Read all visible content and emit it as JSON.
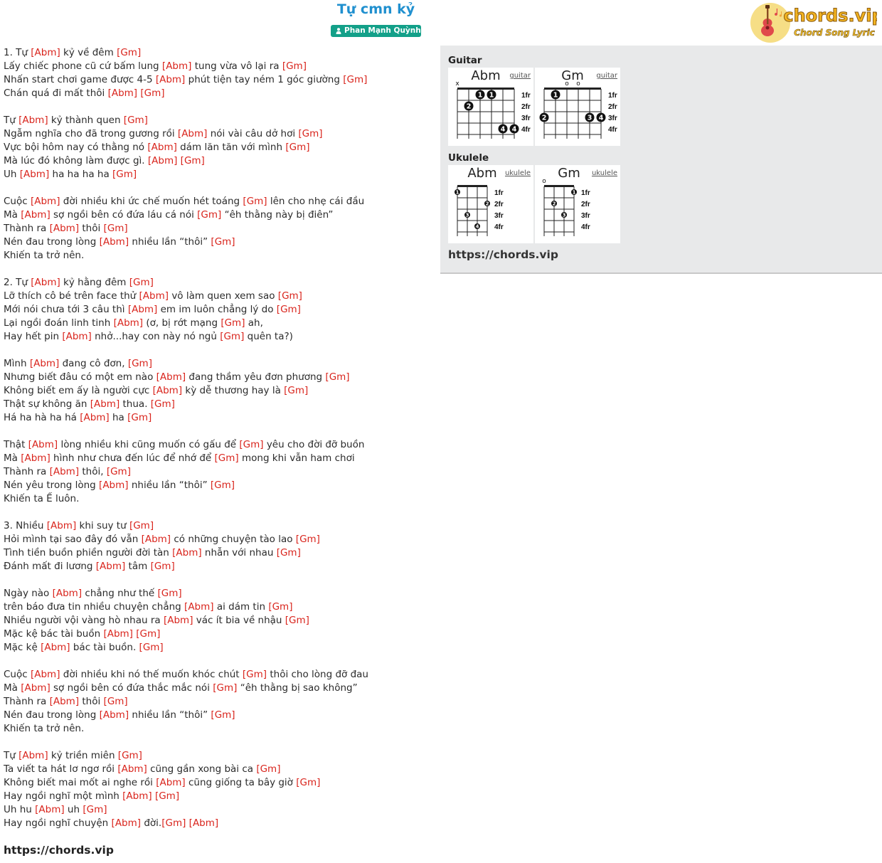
{
  "header": {
    "title": "Tự cmn kỷ",
    "artist": "Phan Mạnh Quỳnh"
  },
  "logo": {
    "brand": "chords.vip",
    "tagline": "Chord Song Lyric"
  },
  "colors": {
    "title": "#2090cf",
    "chord": "#d9241c",
    "badge": "#13a089",
    "panel": "#e8e9ea"
  },
  "lyrics": [
    [
      "1. Tự ",
      "[Abm]",
      " kỷ về đêm ",
      "[Gm]"
    ],
    [
      "Lấy chiếc phone cũ cứ bấm lung ",
      "[Abm]",
      " tung vừa vô lại ra ",
      "[Gm]"
    ],
    [
      "Nhấn start chơi game được 4-5 ",
      "[Abm]",
      " phút tiện tay ném 1 góc giường ",
      "[Gm]"
    ],
    [
      "Chán quá đi mất thôi ",
      "[Abm]",
      " ",
      "[Gm]"
    ],
    [],
    [
      "Tự ",
      "[Abm]",
      " kỷ thành quen ",
      "[Gm]"
    ],
    [
      "Ngẫm nghĩa cho đã trong gương rồi ",
      "[Abm]",
      " nói vài câu dở hơi ",
      "[Gm]"
    ],
    [
      "Vực bội hôm nay có thằng nó ",
      "[Abm]",
      " dám lăn tăn với mình ",
      "[Gm]"
    ],
    [
      "Mà lúc đó không làm được gì. ",
      "[Abm]",
      " ",
      "[Gm]"
    ],
    [
      "Uh ",
      "[Abm]",
      " ha ha ha ha ",
      "[Gm]"
    ],
    [],
    [
      "Cuộc ",
      "[Abm]",
      " đời nhiều khi ức chế muốn hét toáng ",
      "[Gm]",
      " lên cho nhẹ cái đầu"
    ],
    [
      "Mà ",
      "[Abm]",
      " sợ ngồi bên có đứa láu cá nói ",
      "[Gm]",
      " “êh thằng này bị điên”"
    ],
    [
      "Thành ra ",
      "[Abm]",
      " thôi ",
      "[Gm]"
    ],
    [
      "Nén đau trong lòng ",
      "[Abm]",
      " nhiều lần “thôi” ",
      "[Gm]"
    ],
    [
      "Khiến ta trở nên."
    ],
    [],
    [
      "2. Tự ",
      "[Abm]",
      " kỷ hằng đêm ",
      "[Gm]"
    ],
    [
      "Lỡ thích cô bé trên face thử ",
      "[Abm]",
      " vô làm quen xem sao ",
      "[Gm]"
    ],
    [
      "Mới nói chưa tới 3 câu thì ",
      "[Abm]",
      " em im luôn chẳng lý do ",
      "[Gm]"
    ],
    [
      "Lại ngồi đoán linh tinh ",
      "[Abm]",
      " (ơ, bị rớt mạng ",
      "[Gm]",
      " ah,"
    ],
    [
      "Hay hết pin ",
      "[Abm]",
      " nhở...hay con này nó ngủ ",
      "[Gm]",
      " quên ta?)"
    ],
    [],
    [
      "Mình ",
      "[Abm]",
      " đang cô đơn, ",
      "[Gm]"
    ],
    [
      "Nhưng biết đâu có một em nào ",
      "[Abm]",
      " đang thầm yêu đơn phương ",
      "[Gm]"
    ],
    [
      "Không biết em ấy là người cực ",
      "[Abm]",
      " kỳ dễ thương hay là ",
      "[Gm]"
    ],
    [
      "Thật sự không ăn ",
      "[Abm]",
      " thua. ",
      "[Gm]"
    ],
    [
      "Há ha hà ha há ",
      "[Abm]",
      " ha ",
      "[Gm]"
    ],
    [],
    [
      "Thật ",
      "[Abm]",
      " lòng nhiều khi cũng muốn có gấu để ",
      "[Gm]",
      " yêu cho đời đỡ buồn"
    ],
    [
      "Mà ",
      "[Abm]",
      " hình như chưa đến lúc để nhớ để ",
      "[Gm]",
      " mong khi vẫn ham chơi"
    ],
    [
      "Thành ra ",
      "[Abm]",
      " thôi, ",
      "[Gm]"
    ],
    [
      "Nén yêu trong lòng ",
      "[Abm]",
      " nhiều lần “thôi” ",
      "[Gm]"
    ],
    [
      "Khiến ta Ế luôn."
    ],
    [],
    [
      "3. Nhiều ",
      "[Abm]",
      " khi suy tư ",
      "[Gm]"
    ],
    [
      "Hỏi mình tại sao đây đó vẫn ",
      "[Abm]",
      " có những chuyện tào lao ",
      "[Gm]"
    ],
    [
      "Tình tiền buồn phiền người đời tàn ",
      "[Abm]",
      " nhẫn với nhau ",
      "[Gm]"
    ],
    [
      "Đánh mất đi lương ",
      "[Abm]",
      " tâm ",
      "[Gm]"
    ],
    [],
    [
      "Ngày nào ",
      "[Abm]",
      " chẳng như thế ",
      "[Gm]"
    ],
    [
      "trên báo đưa tin nhiều chuyện chẳng ",
      "[Abm]",
      " ai dám tin ",
      "[Gm]"
    ],
    [
      "Nhiều người vội vàng hò nhau ra ",
      "[Abm]",
      " vác ít bia về nhậu ",
      "[Gm]"
    ],
    [
      "Mặc kệ bác tài buồn ",
      "[Abm]",
      " ",
      "[Gm]"
    ],
    [
      "Mặc kệ ",
      "[Abm]",
      " bác tài buồn. ",
      "[Gm]"
    ],
    [],
    [
      "Cuộc ",
      "[Abm]",
      " đời nhiều khi nó thế muốn khóc chút ",
      "[Gm]",
      " thôi cho lòng đỡ đau"
    ],
    [
      "Mà ",
      "[Abm]",
      " sợ ngồi bên có đứa thắc mắc nói ",
      "[Gm]",
      " “êh thằng bị sao không”"
    ],
    [
      "Thành ra ",
      "[Abm]",
      " thôi ",
      "[Gm]"
    ],
    [
      "Nén đau trong lòng ",
      "[Abm]",
      " nhiều lần “thôi” ",
      "[Gm]"
    ],
    [
      "Khiến ta trở nên."
    ],
    [],
    [
      "Tự ",
      "[Abm]",
      " kỷ triền miên ",
      "[Gm]"
    ],
    [
      "Ta viết ta hát lơ ngơ rồi ",
      "[Abm]",
      " cũng gần xong bài ca ",
      "[Gm]"
    ],
    [
      "Không biết mai mốt ai nghe rồi ",
      "[Abm]",
      " cũng giống ta bây giờ ",
      "[Gm]"
    ],
    [
      "Hay ngồi nghĩ một mình ",
      "[Abm]",
      " ",
      "[Gm]"
    ],
    [
      "Uh hu ",
      "[Abm]",
      " uh ",
      "[Gm]"
    ],
    [
      "Hay ngồi nghĩ chuyện ",
      "[Abm]",
      " đời.",
      "[Gm]",
      " ",
      "[Abm]"
    ]
  ],
  "footer": {
    "url": "https://chords.vip"
  },
  "chord_panel": {
    "guitar_heading": "Guitar",
    "ukulele_heading": "Ukulele",
    "url": "https://chords.vip",
    "guitar": [
      {
        "name": "Abm",
        "instrument": "guitar",
        "top_markers": [
          "x",
          "",
          "",
          "",
          "",
          ""
        ],
        "fret_labels": [
          "1fr",
          "2fr",
          "3fr",
          "4fr"
        ],
        "dots": [
          {
            "string": 3,
            "fret": 1,
            "finger": "1"
          },
          {
            "string": 4,
            "fret": 1,
            "finger": "1"
          },
          {
            "string": 2,
            "fret": 2,
            "finger": "2"
          },
          {
            "string": 5,
            "fret": 4,
            "finger": "4"
          },
          {
            "string": 6,
            "fret": 4,
            "finger": "4"
          }
        ]
      },
      {
        "name": "Gm",
        "instrument": "guitar",
        "top_markers": [
          "",
          "",
          "o",
          "o",
          "",
          ""
        ],
        "fret_labels": [
          "1fr",
          "2fr",
          "3fr",
          "4fr"
        ],
        "dots": [
          {
            "string": 2,
            "fret": 1,
            "finger": "1"
          },
          {
            "string": 1,
            "fret": 3,
            "finger": "2"
          },
          {
            "string": 5,
            "fret": 3,
            "finger": "3"
          },
          {
            "string": 6,
            "fret": 3,
            "finger": "4"
          }
        ]
      }
    ],
    "ukulele": [
      {
        "name": "Abm",
        "instrument": "ukulele",
        "top_markers": [
          "",
          "",
          "",
          ""
        ],
        "fret_labels": [
          "1fr",
          "2fr",
          "3fr",
          "4fr"
        ],
        "dots": [
          {
            "string": 1,
            "fret": 1,
            "finger": "1"
          },
          {
            "string": 4,
            "fret": 2,
            "finger": "2"
          },
          {
            "string": 2,
            "fret": 3,
            "finger": "3"
          },
          {
            "string": 3,
            "fret": 4,
            "finger": "4"
          }
        ]
      },
      {
        "name": "Gm",
        "instrument": "ukulele",
        "top_markers": [
          "o",
          "",
          "",
          ""
        ],
        "fret_labels": [
          "1fr",
          "2fr",
          "3fr",
          "4fr"
        ],
        "dots": [
          {
            "string": 4,
            "fret": 1,
            "finger": "1"
          },
          {
            "string": 2,
            "fret": 2,
            "finger": "2"
          },
          {
            "string": 3,
            "fret": 3,
            "finger": "3"
          }
        ]
      }
    ]
  }
}
